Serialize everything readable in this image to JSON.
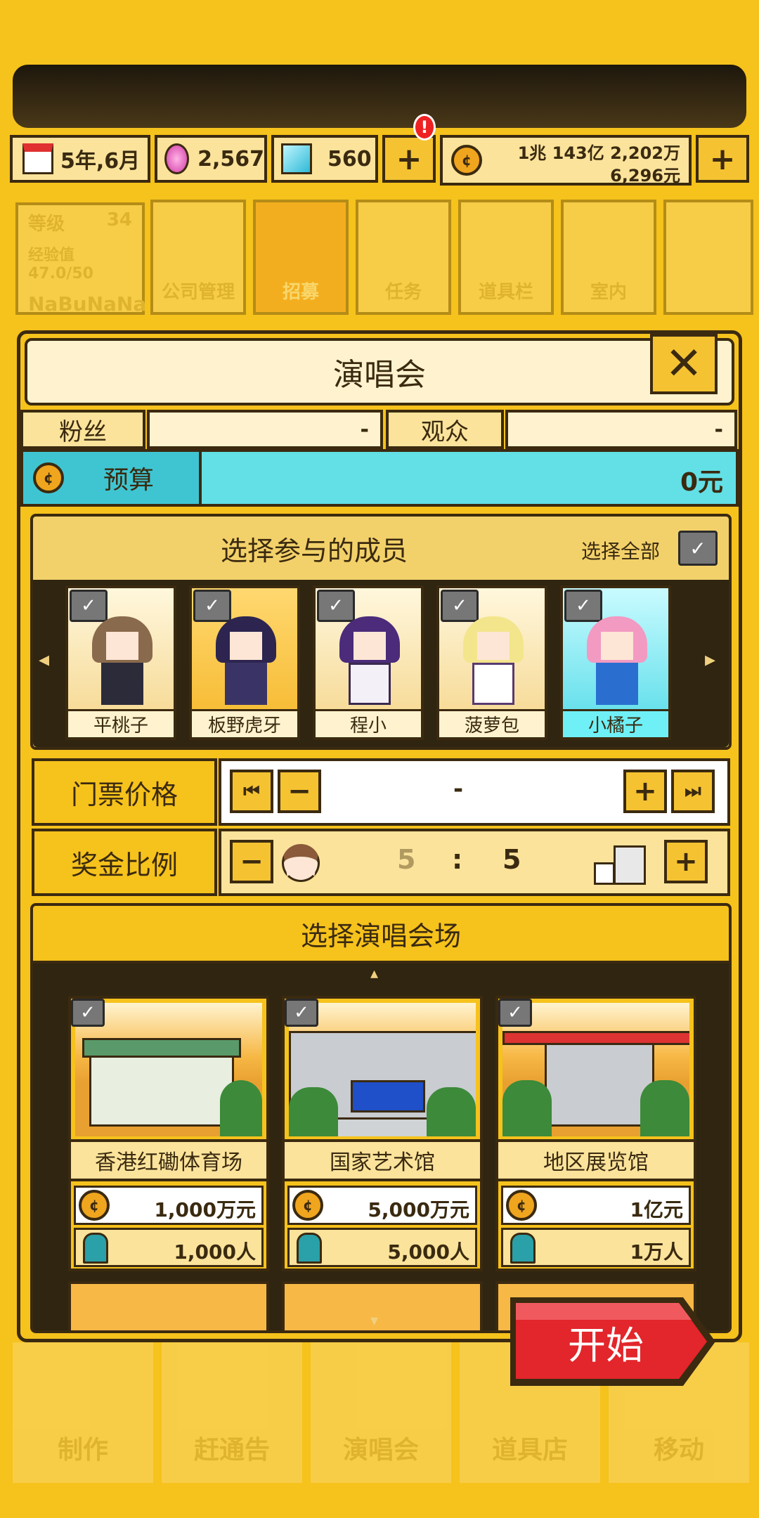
{
  "top_status": {
    "date": "5年,6月",
    "gems_pink": "2,567",
    "gems_blue": "560",
    "alert_badge": "!",
    "money_line1": "1兆 143亿 2,202万",
    "money_line2": "6,296元"
  },
  "player": {
    "level_label": "等级",
    "level_value": "34",
    "exp_label": "经验值 47.0/50",
    "name": "NaBuNaNa"
  },
  "main_nav": [
    "公司管理",
    "招募",
    "任务",
    "道具栏",
    "室内"
  ],
  "bottom_nav": [
    "制作",
    "赶通告",
    "演唱会",
    "道具店",
    "移动"
  ],
  "dialog": {
    "title": "演唱会",
    "fans_label": "粉丝",
    "fans_value": "-",
    "audience_label": "观众",
    "audience_value": "-",
    "budget_label": "预算",
    "budget_value": "0元"
  },
  "members_section": {
    "title": "选择参与的成员",
    "select_all": "选择全部",
    "members": [
      {
        "name": "平桃子",
        "hair": "#8a6a4c"
      },
      {
        "name": "板野虎牙",
        "hair": "#2d2550"
      },
      {
        "name": "程小",
        "hair": "#4b2b7a"
      },
      {
        "name": "菠萝包",
        "hair": "#f3e58c"
      },
      {
        "name": "小橘子",
        "hair": "#f29ac2"
      }
    ]
  },
  "ticket": {
    "label": "门票价格",
    "value": "-"
  },
  "bonus": {
    "label": "奖金比例",
    "left": "5",
    "sep": ":",
    "right": "5"
  },
  "venue_section": {
    "title": "选择演唱会场",
    "venues": [
      {
        "name": "香港红磡体育场",
        "cost": "1,000万元",
        "capacity": "1,000人"
      },
      {
        "name": "国家艺术馆",
        "cost": "5,000万元",
        "capacity": "5,000人"
      },
      {
        "name": "地区展览馆",
        "cost": "1亿元",
        "capacity": "1万人"
      }
    ]
  },
  "start_button": "开始",
  "colors": {
    "background": "#f6c21c",
    "budget_cyan": "#63dfe6",
    "start_red": "#e2262b"
  }
}
